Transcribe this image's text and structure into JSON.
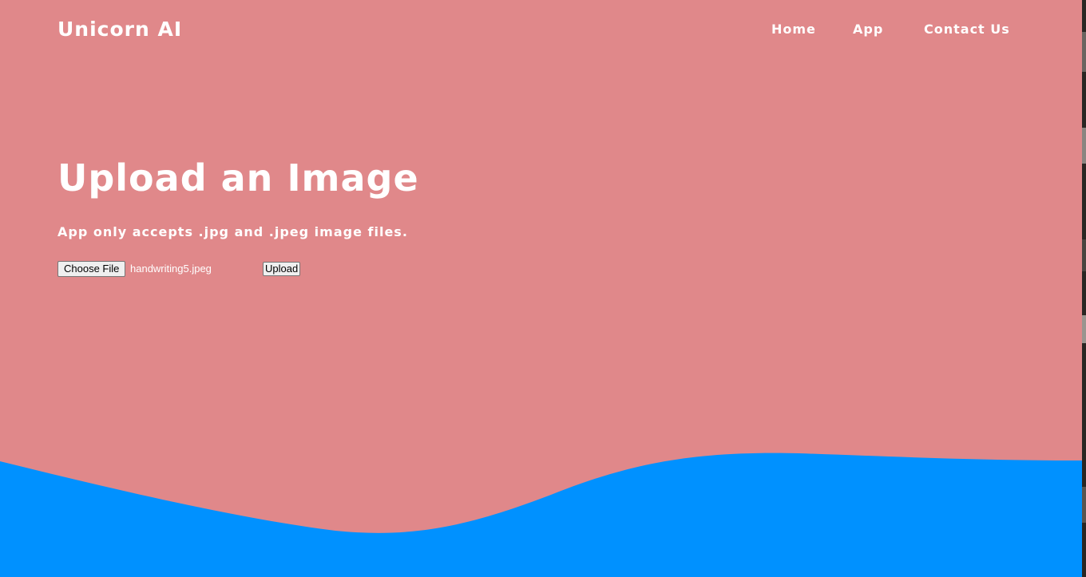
{
  "header": {
    "brand": "Unicorn AI",
    "nav": [
      {
        "label": "Home"
      },
      {
        "label": "App"
      },
      {
        "label": "Contact Us"
      }
    ]
  },
  "main": {
    "title": "Upload an Image",
    "subtitle": "App only accepts .jpg and .jpeg image files.",
    "file_input": {
      "button_label": "Choose File",
      "selected_file": "handwriting5.jpeg"
    },
    "upload_label": "Upload"
  },
  "colors": {
    "background": "#e0888a",
    "wave": "#0091ff",
    "text": "#ffffff"
  }
}
